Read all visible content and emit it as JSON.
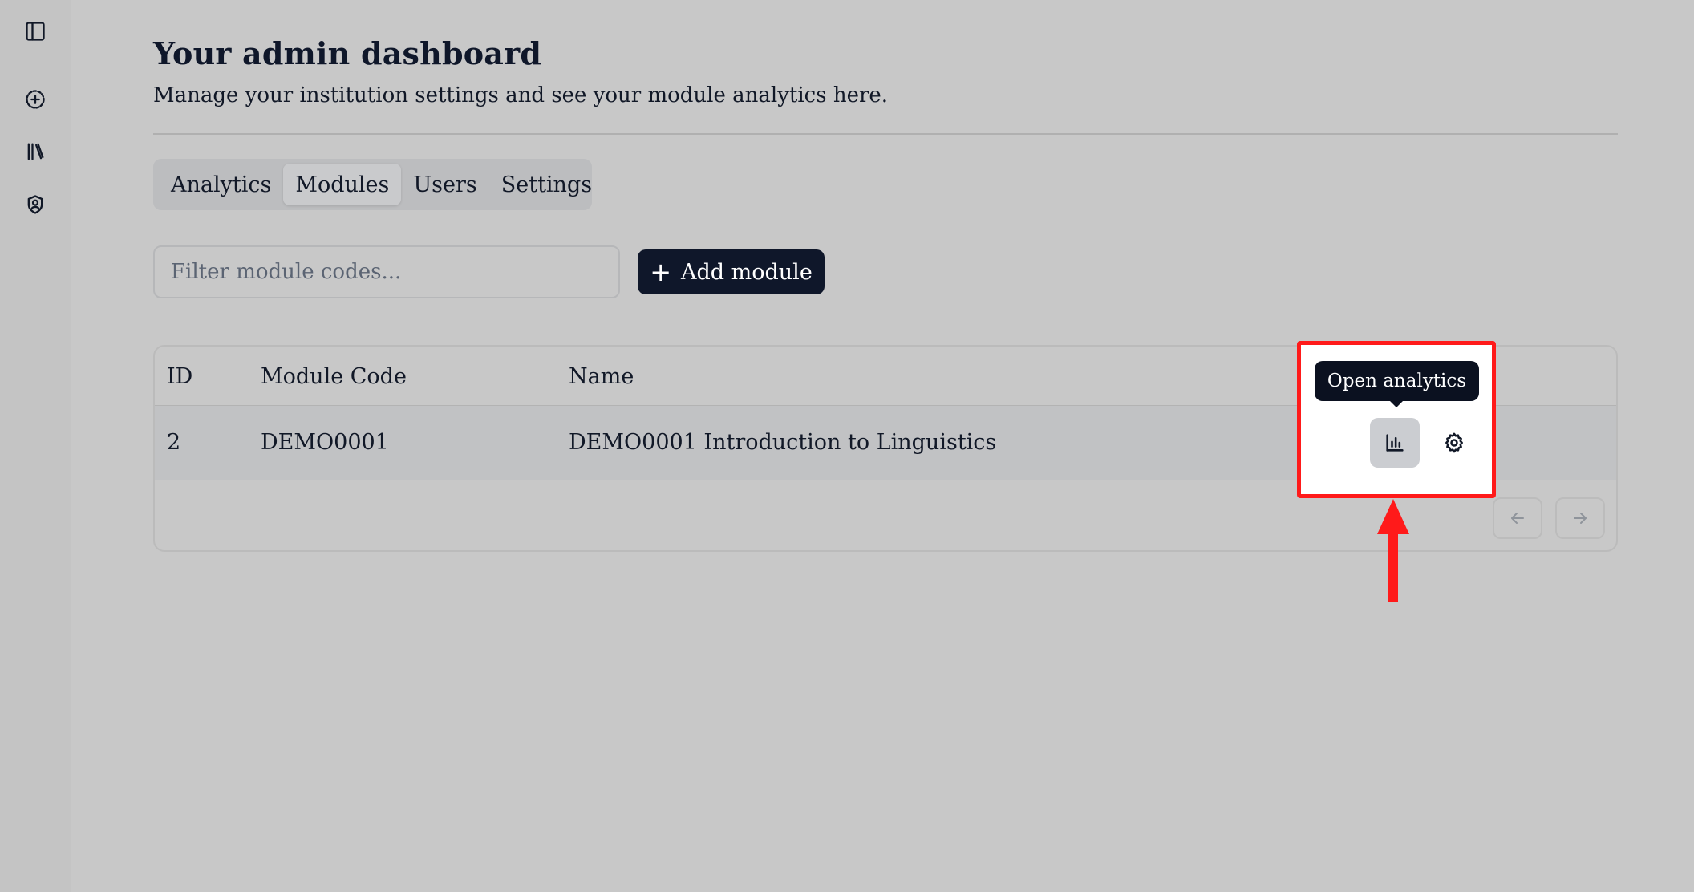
{
  "header": {
    "title": "Your admin dashboard",
    "subtitle": "Manage your institution settings and see your module analytics here."
  },
  "sidebar": {
    "items": [
      {
        "icon": "panel-toggle-icon"
      },
      {
        "icon": "add-circle-icon"
      },
      {
        "icon": "library-icon"
      },
      {
        "icon": "shield-user-icon"
      }
    ]
  },
  "tabs": [
    {
      "label": "Analytics",
      "active": false
    },
    {
      "label": "Modules",
      "active": true
    },
    {
      "label": "Users",
      "active": false
    },
    {
      "label": "Settings",
      "active": false
    }
  ],
  "toolbar": {
    "filter_placeholder": "Filter module codes...",
    "add_label": "Add module"
  },
  "table": {
    "columns": [
      "ID",
      "Module Code",
      "Name"
    ],
    "rows": [
      {
        "id": "2",
        "code": "DEMO0001",
        "name": "DEMO0001 Introduction to Linguistics"
      }
    ]
  },
  "tooltip": {
    "text": "Open analytics"
  },
  "colors": {
    "accent": "#0f172a",
    "highlight": "#ff1a1a",
    "background": "#c8c8c8"
  }
}
